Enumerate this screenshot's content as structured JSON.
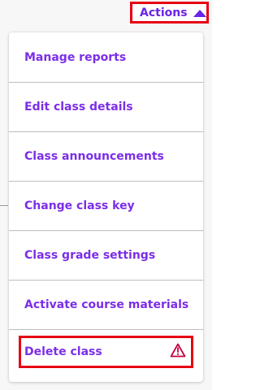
{
  "header": {
    "actions_label": "Actions",
    "actions_icon": "caret-up-icon"
  },
  "menu": {
    "items": [
      {
        "label": "Manage reports"
      },
      {
        "label": "Edit class details"
      },
      {
        "label": "Class announcements"
      },
      {
        "label": "Change class key"
      },
      {
        "label": "Class grade settings"
      },
      {
        "label": "Activate course materials"
      },
      {
        "label": "Delete class",
        "icon": "warning-icon"
      }
    ]
  },
  "colors": {
    "accent": "#7b2ee8",
    "highlight": "#e60012",
    "warning": "#c4003d"
  }
}
